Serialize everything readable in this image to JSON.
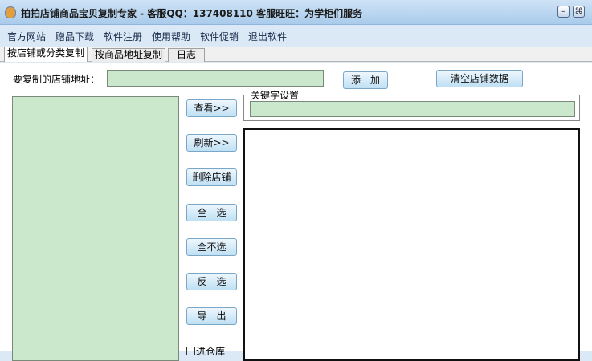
{
  "title": "拍拍店铺商品宝贝复制专家 - 客服QQ：137408110 客服旺旺：为学柜们服务",
  "window_buttons": {
    "minimize": "–",
    "close": "⌘"
  },
  "menu": [
    "官方网站",
    "赠品下载",
    "软件注册",
    "使用帮助",
    "软件促销",
    "退出软件"
  ],
  "tabs": [
    "按店铺或分类复制",
    "按商品地址复制",
    "日志"
  ],
  "shop_url_label": "要复制的店铺地址：",
  "shop_url_value": "",
  "add_button": "添　加",
  "clear_button": "清空店铺数据",
  "side_buttons": [
    "查看>>",
    "刷新>>",
    "删除店铺",
    "全　选",
    "全不选",
    "反　选",
    "导　出"
  ],
  "keyword_legend": "关键字设置",
  "keyword_value": "",
  "checkbox_label": "进仓库"
}
